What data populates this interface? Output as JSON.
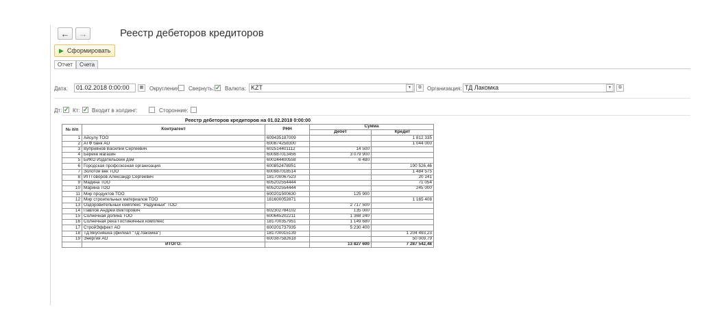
{
  "header": {
    "title": "Реестр дебеторов кредиторов",
    "back_icon": "arrow-left-icon",
    "forward_icon": "arrow-right-icon"
  },
  "toolbar": {
    "generate_label": "Сформировать"
  },
  "tabs": [
    {
      "label": "Отчет",
      "active": true
    },
    {
      "label": "Счета",
      "active": false
    }
  ],
  "filters": {
    "date_label": "Дата:",
    "date_value": "01.02.2018  0:00:00",
    "rounding_label": "Округления:",
    "rounding_checked": false,
    "collapse_label": "Свернуть:",
    "collapse_checked": true,
    "currency_label": "Валюта:",
    "currency_value": "KZT",
    "org_label": "Организация:",
    "org_value": "ТД Лакомка",
    "dt_label": "Дт:",
    "dt_checked": true,
    "kt_label": "Кт:",
    "kt_checked": true,
    "holding_label": "Входит в холдинг:",
    "holding_checked": false,
    "third_label": "Сторонние:",
    "third_checked": false
  },
  "report": {
    "caption": "Реестр дебеторов кредиторов на 01.02.2018 0:00:00",
    "headers": {
      "no": "№ п/п",
      "name": "Контрагент",
      "rnn": "РНН",
      "sum": "Сумма",
      "debit": "Дебет",
      "credit": "Кредит"
    },
    "rows": [
      {
        "no": "1",
        "name": "Айсулу ТОО",
        "rnn": "609435187009",
        "debit": "",
        "credit": "1 812 335"
      },
      {
        "no": "2",
        "name": "АТФ банк АО",
        "rnn": "600874258300",
        "debit": "",
        "credit": "1 044 000"
      },
      {
        "no": "3",
        "name": "Вуприянов Василий Сергеевич",
        "rnn": "602514401112",
        "debit": "14 500",
        "credit": ""
      },
      {
        "no": "4",
        "name": "Береке магазин",
        "rnn": "600987013456",
        "debit": "3 079 900",
        "credit": ""
      },
      {
        "no": "5",
        "name": "БИКО Издательский дом",
        "rnn": "600244400558",
        "debit": "6 480",
        "credit": ""
      },
      {
        "no": "6",
        "name": "Городская профсоюзная организация",
        "rnn": "600852478951",
        "debit": "",
        "credit": "190 526,46"
      },
      {
        "no": "7",
        "name": "Золотой век ТОО",
        "rnn": "600987018514",
        "debit": "",
        "credit": "1 484 575"
      },
      {
        "no": "8",
        "name": "ИП Говоров Александр Сергеевич",
        "rnn": "181700067523",
        "debit": "",
        "credit": "20 141"
      },
      {
        "no": "9",
        "name": "Мадина ТОО",
        "rnn": "605202554444",
        "debit": "",
        "credit": "71 054"
      },
      {
        "no": "10",
        "name": "Марина ТОО",
        "rnn": "605202554444",
        "debit": "",
        "credit": "245 000"
      },
      {
        "no": "11",
        "name": "Мир продуктов ТОО",
        "rnn": "600201500630",
        "debit": "125 900",
        "credit": ""
      },
      {
        "no": "12",
        "name": "Мир строительных материалов ТОО",
        "rnn": "181600052871",
        "debit": "",
        "credit": "1 165 408"
      },
      {
        "no": "13",
        "name": "Оздоровительный комплекс \"Радужный\" ТОО",
        "rnn": "",
        "debit": "2 717 500",
        "credit": ""
      },
      {
        "no": "14",
        "name": "Павлов Андрей Викторович",
        "rnn": "602302784102",
        "debit": "135 000",
        "credit": ""
      },
      {
        "no": "15",
        "name": "Солнечная долина ТОО",
        "rnn": "600645202211",
        "debit": "1 368 240",
        "credit": ""
      },
      {
        "no": "16",
        "name": "Солнечная река Гостиничный комплекс",
        "rnn": "181700357951",
        "debit": "1 149 680",
        "credit": ""
      },
      {
        "no": "17",
        "name": "СтройЭффект АО",
        "rnn": "600201737935",
        "debit": "5 230 400",
        "credit": ""
      },
      {
        "no": "18",
        "name": "ТД Вкусняшка (филиал \"ТД Лакомка\")",
        "rnn": "181700015139",
        "debit": "",
        "credit": "1 204 493,23"
      },
      {
        "no": "19",
        "name": "Энергия АО",
        "rnn": "600387582618",
        "debit": "",
        "credit": "50 009,79"
      }
    ],
    "total": {
      "label": "ИТОГО:",
      "debit": "13 827 600",
      "credit": "7 287 542,48"
    }
  }
}
